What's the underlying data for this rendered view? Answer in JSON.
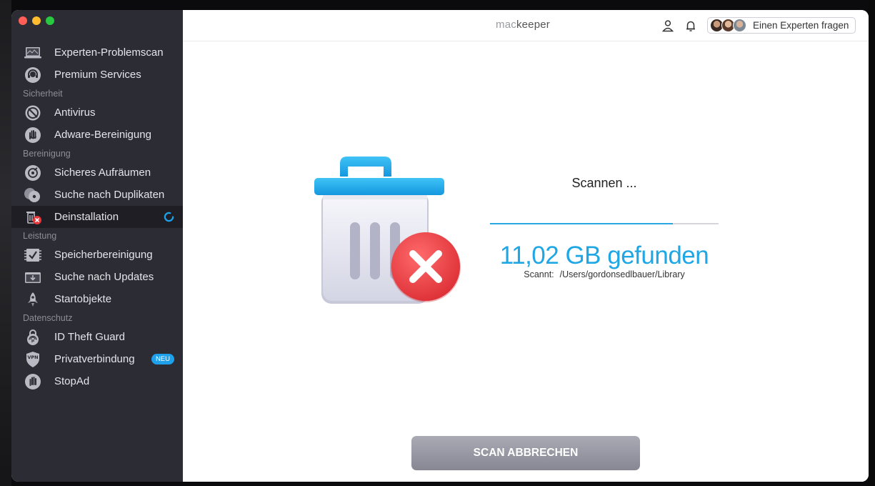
{
  "app": {
    "logo_mac": "mac",
    "logo_keeper": "keeper"
  },
  "sidebar": {
    "top_items": [
      {
        "label": "Experten-Problemscan",
        "icon": "laptop-scan-icon"
      },
      {
        "label": "Premium Services",
        "icon": "headset-icon"
      }
    ],
    "sections": [
      {
        "title": "Sicherheit",
        "items": [
          {
            "label": "Antivirus",
            "icon": "antivirus-icon"
          },
          {
            "label": "Adware-Bereinigung",
            "icon": "hand-stop-icon"
          }
        ]
      },
      {
        "title": "Bereinigung",
        "items": [
          {
            "label": "Sicheres Aufräumen",
            "icon": "disk-cleanup-icon"
          },
          {
            "label": "Suche nach Duplikaten",
            "icon": "duplicates-icon"
          },
          {
            "label": "Deinstallation",
            "icon": "uninstaller-icon",
            "active": true,
            "spinner": true
          }
        ]
      },
      {
        "title": "Leistung",
        "items": [
          {
            "label": "Speicherbereinigung",
            "icon": "memory-icon"
          },
          {
            "label": "Suche nach Updates",
            "icon": "update-icon"
          },
          {
            "label": "Startobjekte",
            "icon": "rocket-icon"
          }
        ]
      },
      {
        "title": "Datenschutz",
        "items": [
          {
            "label": "ID Theft Guard",
            "icon": "fingerprint-lock-icon"
          },
          {
            "label": "Privatverbindung",
            "icon": "vpn-shield-icon",
            "badge": "NEU"
          },
          {
            "label": "StopAd",
            "icon": "stop-hand-icon"
          }
        ]
      }
    ]
  },
  "header": {
    "expert_button": "Einen Experten fragen"
  },
  "scan": {
    "title": "Scannen ...",
    "progress": 0.8,
    "found": "11,02 GB gefunden",
    "path_label": "Scannt:",
    "path": "/Users/gordonsedlbauer/Library",
    "cancel_button": "SCAN ABBRECHEN"
  },
  "colors": {
    "accent": "#1ea7e4",
    "sidebar_bg": "#2c2c34",
    "badge": "#1ea0ea",
    "danger": "#e8383d"
  }
}
